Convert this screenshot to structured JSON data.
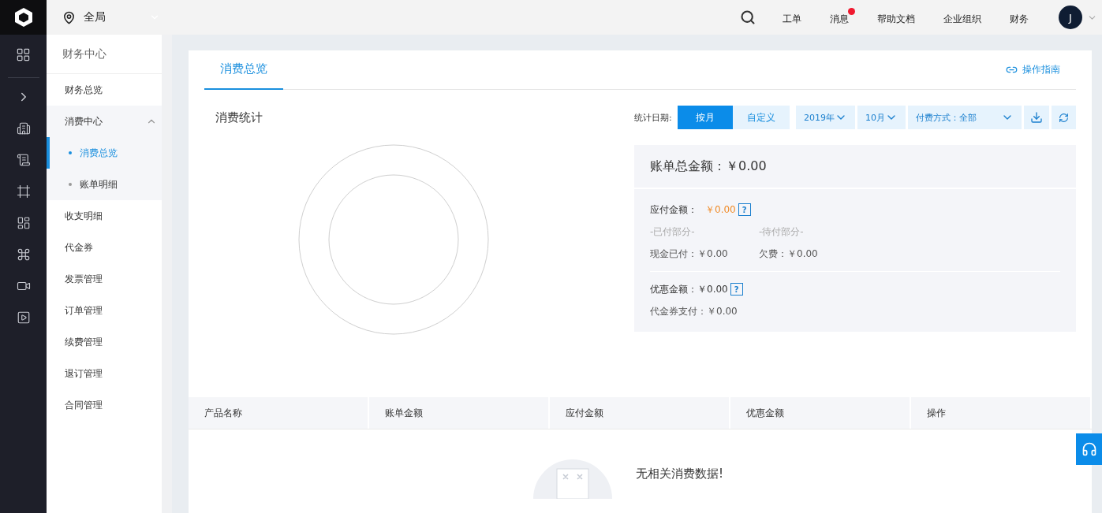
{
  "top_bar": {
    "location": "全局",
    "nav": [
      {
        "label": "工单",
        "unread": false
      },
      {
        "label": "消息",
        "unread": true
      },
      {
        "label": "帮助文档",
        "unread": false
      },
      {
        "label": "企业组织",
        "unread": false
      },
      {
        "label": "财务",
        "unread": false
      }
    ],
    "avatar": "J"
  },
  "sidebar": {
    "title": "财务中心",
    "items": [
      {
        "label": "财务总览",
        "selected": false
      },
      {
        "label": "消费中心",
        "selected": false,
        "expanded": true,
        "children": [
          {
            "label": "消费总览",
            "selected": true
          },
          {
            "label": "账单明细",
            "selected": false
          }
        ]
      },
      {
        "label": "收支明细",
        "selected": false
      },
      {
        "label": "代金券",
        "selected": false
      },
      {
        "label": "发票管理",
        "selected": false
      },
      {
        "label": "订单管理",
        "selected": false
      },
      {
        "label": "续费管理",
        "selected": false
      },
      {
        "label": "退订管理",
        "selected": false
      },
      {
        "label": "合同管理",
        "selected": false
      }
    ]
  },
  "tabs": [
    {
      "label": "消费总览",
      "selected": true
    }
  ],
  "guide_link": "操作指南",
  "section_title": "消费统计",
  "filters": {
    "date_label": "统计日期:",
    "modes": [
      {
        "label": "按月",
        "selected": true
      },
      {
        "label": "自定义",
        "selected": false
      }
    ],
    "year": "2019年",
    "month": "10月",
    "payment": "付费方式：全部"
  },
  "summary": {
    "total_label": "账单总金额：",
    "total_value": "￥0.00",
    "payable_label": "应付金额：",
    "payable_value": "￥0.00",
    "paid_header": "-已付部分-",
    "pending_header": "-待付部分-",
    "cash_paid": "现金已付：￥0.00",
    "arrears": "欠费：￥0.00",
    "discount_label": "优惠金额：",
    "discount_value": "￥0.00",
    "voucher_paid": "代金券支付：￥0.00",
    "help_mark": "?"
  },
  "table": {
    "columns": [
      "产品名称",
      "账单金额",
      "应付金额",
      "优惠金额",
      "操作"
    ],
    "empty_text": "无相关消费数据!"
  }
}
